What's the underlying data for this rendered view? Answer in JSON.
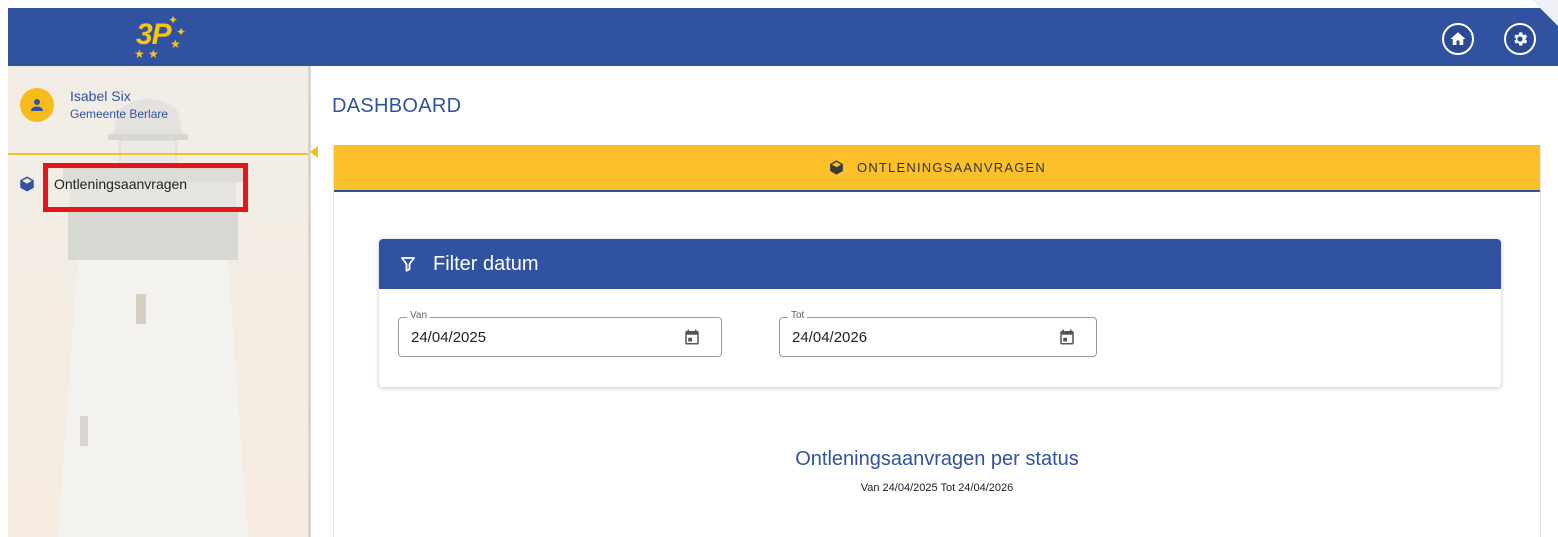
{
  "app": {
    "logo_text": "3P",
    "home_icon": "home-icon",
    "settings_icon": "gear-icon",
    "colors": {
      "primary": "#3152a0",
      "accent": "#fcc12a",
      "highlight": "#e8141b"
    }
  },
  "sidebar": {
    "user": {
      "name": "Isabel Six",
      "organization": "Gemeente Berlare",
      "icon": "user-icon"
    },
    "items": [
      {
        "label": "Ontleningsaanvragen",
        "icon": "cube-icon"
      }
    ]
  },
  "main": {
    "title": "DASHBOARD",
    "card": {
      "header_label": "ONTLENINGSAANVRAGEN",
      "header_icon": "cube-icon",
      "filter": {
        "title": "Filter datum",
        "icon": "filter-icon",
        "from": {
          "label": "Van",
          "value": "24/04/2025",
          "icon": "calendar-icon"
        },
        "to": {
          "label": "Tot",
          "value": "24/04/2026",
          "icon": "calendar-icon"
        }
      },
      "chart": {
        "title": "Ontleningsaanvragen per status",
        "subtitle": "Van 24/04/2025 Tot 24/04/2026"
      }
    }
  }
}
